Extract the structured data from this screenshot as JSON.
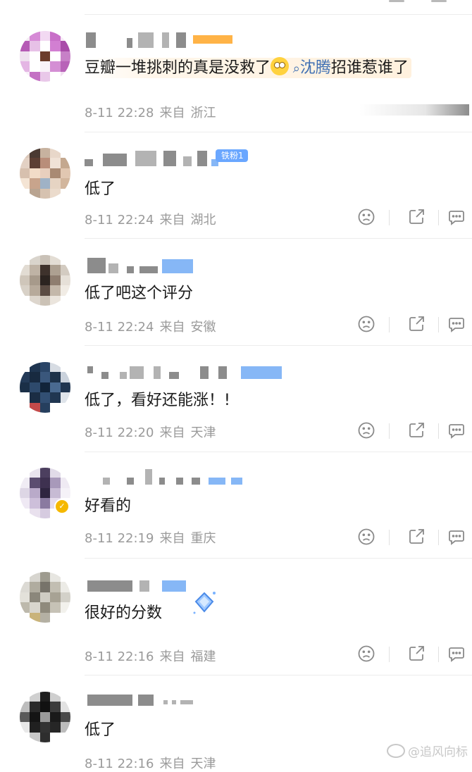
{
  "comments": [
    {
      "text_plain": "豆瓣一堆挑刺的真是没救了",
      "emoji": "roll-eyes-emoji",
      "link_text": "沈腾",
      "text_tail": "招谁惹谁了",
      "time": "8-11 22:28",
      "from": "来自",
      "location": "浙江"
    },
    {
      "badge": "铁粉1",
      "text": "低了",
      "time": "8-11 22:24",
      "from": "来自",
      "location": "湖北"
    },
    {
      "text": "低了吧这个评分",
      "time": "8-11 22:24",
      "from": "来自",
      "location": "安徽"
    },
    {
      "text": "低了，看好还能涨！!",
      "time": "8-11 22:20",
      "from": "来自",
      "location": "天津"
    },
    {
      "text": "好看的",
      "time": "8-11 22:19",
      "from": "来自",
      "location": "重庆"
    },
    {
      "text": "很好的分数",
      "time": "8-11 22:16",
      "from": "来自",
      "location": "福建"
    },
    {
      "text": "低了",
      "time": "8-11 22:16",
      "from": "来自",
      "location": "天津"
    }
  ],
  "watermark": "@追风向标",
  "icons": {
    "dislike": "sad-face-icon",
    "share": "share-icon",
    "reply": "comment-icon",
    "search": "search-icon",
    "verified": "verified-badge-icon"
  },
  "colors": {
    "link": "#3f6fb3",
    "badge": "#6aa7ff",
    "meta": "#9a9a9a",
    "verified": "#f5b800"
  }
}
